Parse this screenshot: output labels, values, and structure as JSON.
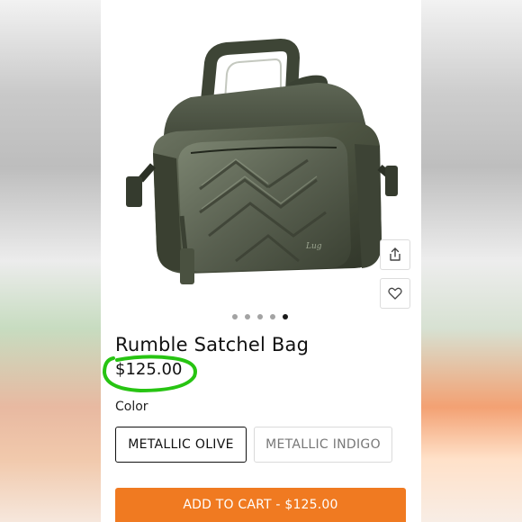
{
  "product": {
    "title": "Rumble Satchel Bag",
    "price": "$125.00",
    "image_alt": "bag-photo"
  },
  "gallery": {
    "dot_count": 5,
    "active_index": 4
  },
  "actions": {
    "share_icon": "share-icon",
    "favorite_icon": "heart-icon"
  },
  "color": {
    "label": "Color",
    "options": [
      "METALLIC OLIVE",
      "METALLIC INDIGO"
    ],
    "selected": "METALLIC OLIVE"
  },
  "cart": {
    "label": "ADD TO CART - $125.00"
  },
  "colors": {
    "accent": "#f07a21",
    "highlight_circle": "#27c412",
    "bag": "#4b5240"
  }
}
